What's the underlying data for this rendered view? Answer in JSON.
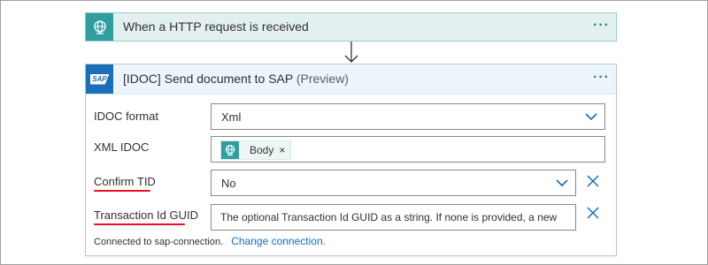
{
  "trigger": {
    "title": "When a HTTP request is received",
    "icon": "globe-request-icon",
    "menu": "···"
  },
  "action": {
    "title": "[IDOC] Send document to SAP",
    "preview": "(Preview)",
    "icon_text": "SAP",
    "menu": "···",
    "fields": {
      "idoc_format": {
        "label": "IDOC format",
        "value": "Xml"
      },
      "xml_idoc": {
        "label": "XML IDOC",
        "token_label": "Body",
        "token_remove": "×"
      },
      "confirm_tid": {
        "label": "Confirm TID",
        "value": "No"
      },
      "transaction_guid": {
        "label": "Transaction Id GUID",
        "placeholder": "The optional Transaction Id GUID as a string. If none is provided, a new"
      }
    },
    "footer": {
      "connected_text": "Connected to sap-connection.",
      "change_link": "Change connection."
    }
  },
  "colors": {
    "trigger_bg": "#e3f0f0",
    "trigger_icon_bg": "#2e9ea0",
    "sap_blue": "#1a6fb8",
    "link": "#0f6cbd",
    "required_underline": "#e81123"
  }
}
